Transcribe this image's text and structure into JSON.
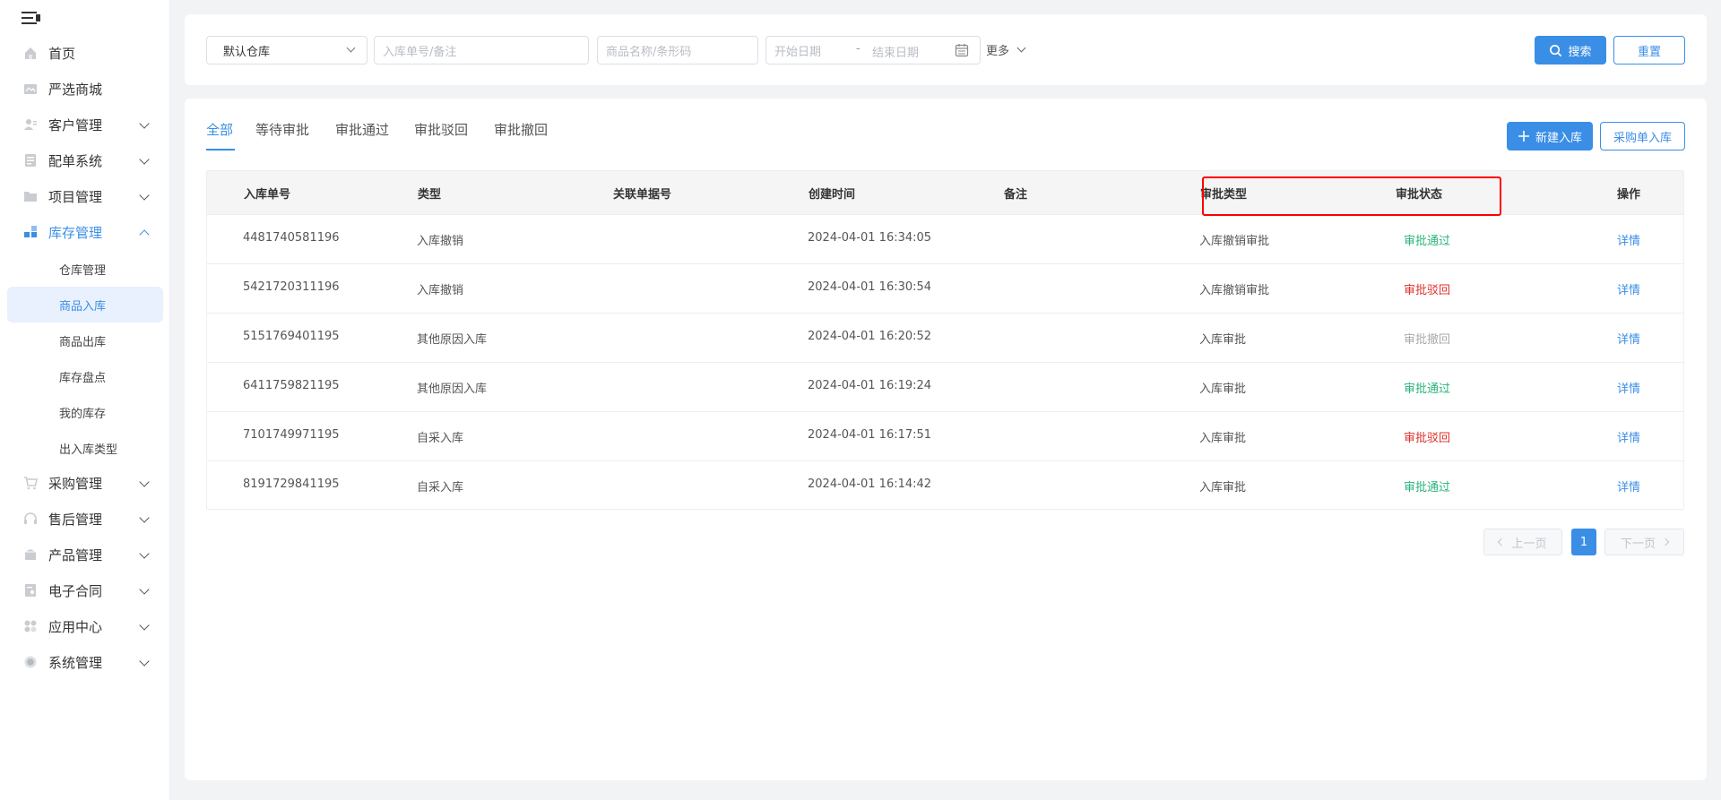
{
  "sidebar": {
    "menu": [
      {
        "label": "首页",
        "icon": "home-icon"
      },
      {
        "label": "严选商城",
        "icon": "mall-icon"
      },
      {
        "label": "客户管理",
        "icon": "customer-icon"
      },
      {
        "label": "配单系统",
        "icon": "order-icon"
      },
      {
        "label": "项目管理",
        "icon": "folder-icon"
      },
      {
        "label": "库存管理",
        "icon": "inventory-icon"
      },
      {
        "label": "采购管理",
        "icon": "cart-icon"
      },
      {
        "label": "售后管理",
        "icon": "headset-icon"
      },
      {
        "label": "产品管理",
        "icon": "box-icon"
      },
      {
        "label": "电子合同",
        "icon": "contract-icon"
      },
      {
        "label": "应用中心",
        "icon": "apps-icon"
      },
      {
        "label": "系统管理",
        "icon": "settings-icon"
      }
    ],
    "submenu": [
      "仓库管理",
      "商品入库",
      "商品出库",
      "库存盘点",
      "我的库存",
      "出入库类型"
    ]
  },
  "filters": {
    "warehouse_value": "默认仓库",
    "order_placeholder": "入库单号/备注",
    "product_placeholder": "商品名称/条形码",
    "start_date_placeholder": "开始日期",
    "date_separator": "-",
    "end_date_placeholder": "结束日期",
    "more_label": "更多",
    "search_label": "搜索",
    "reset_label": "重置"
  },
  "tabs": [
    "全部",
    "等待审批",
    "审批通过",
    "审批驳回",
    "审批撤回"
  ],
  "actions": {
    "new_label": "新建入库",
    "purchase_label": "采购单入库"
  },
  "table": {
    "headers": [
      "入库单号",
      "类型",
      "关联单据号",
      "创建时间",
      "备注",
      "审批类型",
      "审批状态",
      "操作"
    ],
    "rows": [
      {
        "id": "4481740581196",
        "type": "入库撤销",
        "ref": "",
        "time": "2024-04-01 16:34:05",
        "note": "",
        "approval_type": "入库撤销审批",
        "status": "审批通过",
        "status_kind": "pass",
        "op": "详情"
      },
      {
        "id": "5421720311196",
        "type": "入库撤销",
        "ref": "",
        "time": "2024-04-01 16:30:54",
        "note": "",
        "approval_type": "入库撤销审批",
        "status": "审批驳回",
        "status_kind": "reject",
        "op": "详情"
      },
      {
        "id": "5151769401195",
        "type": "其他原因入库",
        "ref": "",
        "time": "2024-04-01 16:20:52",
        "note": "",
        "approval_type": "入库审批",
        "status": "审批撤回",
        "status_kind": "withdraw",
        "op": "详情"
      },
      {
        "id": "6411759821195",
        "type": "其他原因入库",
        "ref": "",
        "time": "2024-04-01 16:19:24",
        "note": "",
        "approval_type": "入库审批",
        "status": "审批通过",
        "status_kind": "pass",
        "op": "详情"
      },
      {
        "id": "7101749971195",
        "type": "自采入库",
        "ref": "",
        "time": "2024-04-01 16:17:51",
        "note": "",
        "approval_type": "入库审批",
        "status": "审批驳回",
        "status_kind": "reject",
        "op": "详情"
      },
      {
        "id": "8191729841195",
        "type": "自采入库",
        "ref": "",
        "time": "2024-04-01 16:14:42",
        "note": "",
        "approval_type": "入库审批",
        "status": "审批通过",
        "status_kind": "pass",
        "op": "详情"
      }
    ]
  },
  "pagination": {
    "prev_label": "上一页",
    "current_page": "1",
    "next_label": "下一页"
  },
  "colors": {
    "primary": "#3a8ee6",
    "pass": "#2ab37b",
    "reject": "#e0322b",
    "withdraw": "#aaaaaa",
    "highlight": "#ff0000"
  }
}
